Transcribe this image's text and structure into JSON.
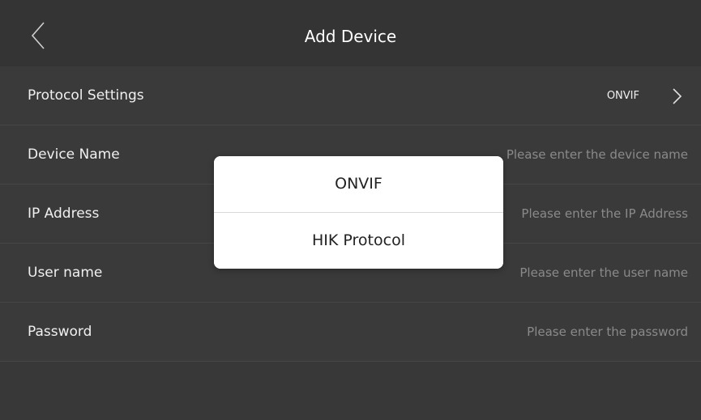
{
  "header": {
    "title": "Add Device",
    "back_icon": "chevron-left-icon"
  },
  "rows": {
    "protocol": {
      "label": "Protocol Settings",
      "value": "ONVIF",
      "icon": "chevron-right-icon"
    },
    "device_name": {
      "label": "Device Name",
      "placeholder": "Please enter the device name"
    },
    "ip_address": {
      "label": "IP Address",
      "placeholder": "Please enter the IP Address"
    },
    "user_name": {
      "label": "User name",
      "placeholder": "Please enter the user name"
    },
    "password": {
      "label": "Password",
      "placeholder": "Please enter the password"
    }
  },
  "popup": {
    "options": [
      "ONVIF",
      "HIK Protocol"
    ]
  },
  "colors": {
    "background": "#383838",
    "header": "#343434",
    "popup": "#ffffff",
    "text_primary": "#f0f0f0",
    "placeholder": "#8a8a8a"
  }
}
